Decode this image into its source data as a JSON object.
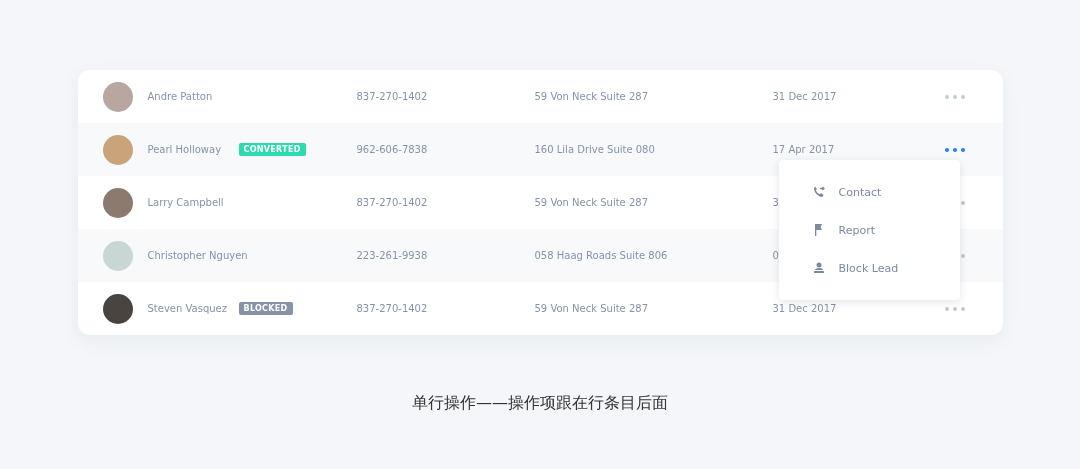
{
  "leads": [
    {
      "name": "Andre Patton",
      "phone": "837-270-1402",
      "address": "59 Von Neck Suite 287",
      "date": "31 Dec 2017",
      "menu_open": false
    },
    {
      "name": "Pearl Holloway",
      "badge": {
        "kind": "converted",
        "text": "CONVERTED"
      },
      "phone": "962-606-7838",
      "address": "160 Lila Drive Suite 080",
      "date": "17 Apr 2017",
      "menu_open": true
    },
    {
      "name": "Larry Campbell",
      "phone": "837-270-1402",
      "address": "59 Von Neck Suite 287",
      "date": "3",
      "menu_open": false
    },
    {
      "name": "Christopher Nguyen",
      "phone": "223-261-9938",
      "address": "058 Haag Roads Suite 806",
      "date": "0",
      "menu_open": false
    },
    {
      "name": "Steven Vasquez",
      "badge": {
        "kind": "blocked",
        "text": "BLOCKED"
      },
      "phone": "837-270-1402",
      "address": "59 Von Neck Suite 287",
      "date": "31 Dec 2017",
      "menu_open": false
    }
  ],
  "action_menu": [
    {
      "kind": "contact",
      "label": "Contact"
    },
    {
      "kind": "report",
      "label": "Report"
    },
    {
      "kind": "block",
      "label": "Block Lead"
    }
  ],
  "caption": "单行操作——操作项跟在行条目后面"
}
